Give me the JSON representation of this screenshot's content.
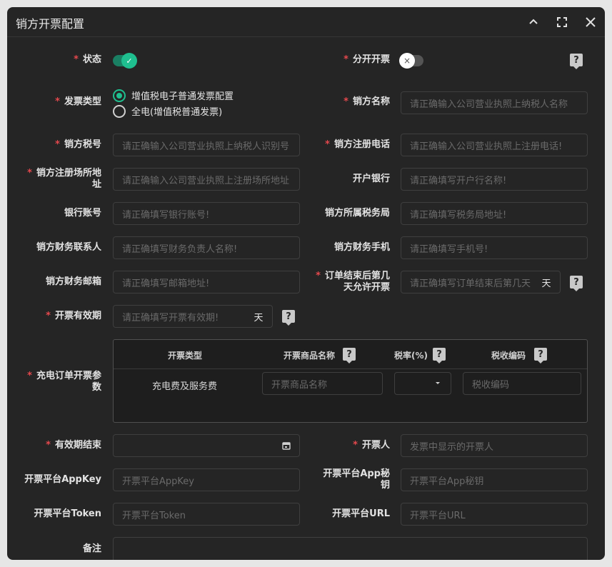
{
  "window": {
    "title": "销方开票配置"
  },
  "fields": {
    "status": {
      "label": "状态"
    },
    "split_invoice": {
      "label": "分开开票"
    },
    "invoice_type": {
      "label": "发票类型",
      "options": [
        "增值税电子普通发票配置",
        "全电(增值税普通发票)"
      ],
      "selected": 0
    },
    "seller_name": {
      "label": "销方名称",
      "placeholder": "请正确输入公司营业执照上纳税人名称"
    },
    "seller_tax_no": {
      "label": "销方税号",
      "placeholder": "请正确输入公司营业执照上纳税人识别号"
    },
    "seller_reg_phone": {
      "label": "销方注册电话",
      "placeholder": "请正确输入公司营业执照上注册电话!"
    },
    "seller_reg_addr": {
      "label_line1": "销方注册场所地",
      "label_line2": "址",
      "placeholder": "请正确输入公司营业执照上注册场所地址"
    },
    "bank": {
      "label": "开户银行",
      "placeholder": "请正确填写开户行名称!"
    },
    "bank_account": {
      "label": "银行账号",
      "placeholder": "请正确填写银行账号!"
    },
    "tax_bureau": {
      "label": "销方所属税务局",
      "placeholder": "请正确填写税务局地址!"
    },
    "finance_contact": {
      "label": "销方财务联系人",
      "placeholder": "请正确填写财务负责人名称!"
    },
    "finance_mobile": {
      "label": "销方财务手机",
      "placeholder": "请正确填写手机号!"
    },
    "finance_email": {
      "label": "销方财务邮箱",
      "placeholder": "请正确填写邮箱地址!"
    },
    "invoice_days_after_order": {
      "label_line1": "订单结束后第几",
      "label_line2": "天允许开票",
      "placeholder": "请正确填写订单结束后第几天",
      "suffix": "天"
    },
    "invoice_validity": {
      "label": "开票有效期",
      "placeholder": "请正确填写开票有效期!",
      "suffix": "天"
    },
    "charge_order_params": {
      "label_line1": "充电订单开票参",
      "label_line2": "数",
      "columns": [
        "开票类型",
        "开票商品名称",
        "税率(%)",
        "税收编码"
      ],
      "row": {
        "type": "充电费及服务费",
        "goods_placeholder": "开票商品名称",
        "tax_code_placeholder": "税收编码"
      }
    },
    "valid_end": {
      "label": "有效期结束"
    },
    "drawer": {
      "label": "开票人",
      "placeholder": "发票中显示的开票人"
    },
    "app_key": {
      "label": "开票平台AppKey",
      "placeholder": "开票平台AppKey"
    },
    "app_secret": {
      "label_line1": "开票平台App秘",
      "label_line2": "钥",
      "placeholder": "开票平台App秘钥"
    },
    "token": {
      "label": "开票平台Token",
      "placeholder": "开票平台Token"
    },
    "url": {
      "label": "开票平台URL",
      "placeholder": "开票平台URL"
    },
    "remark": {
      "label": "备注"
    }
  },
  "colors": {
    "accent": "#1fbf8f",
    "required": "#e5484d",
    "background": "#252525"
  },
  "icons": [
    "chevron-up-icon",
    "fullscreen-icon",
    "close-icon",
    "help-icon",
    "calendar-icon",
    "caret-down-icon",
    "check-icon"
  ]
}
